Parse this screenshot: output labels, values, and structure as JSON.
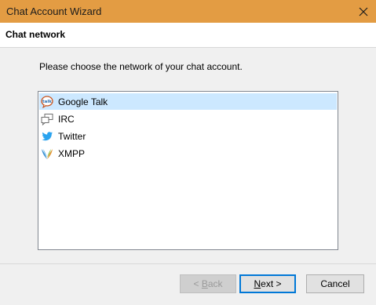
{
  "window": {
    "title": "Chat Account Wizard",
    "close_icon": "close-icon"
  },
  "header": {
    "title": "Chat network"
  },
  "prompt": "Please choose the network of your chat account.",
  "networks": [
    {
      "label": "Google Talk",
      "icon": "google-talk-icon",
      "selected": true
    },
    {
      "label": "IRC",
      "icon": "irc-icon",
      "selected": false
    },
    {
      "label": "Twitter",
      "icon": "twitter-icon",
      "selected": false
    },
    {
      "label": "XMPP",
      "icon": "xmpp-icon",
      "selected": false
    }
  ],
  "buttons": {
    "back": {
      "prefix": "< ",
      "accel": "B",
      "rest": "ack",
      "enabled": false
    },
    "next": {
      "accel": "N",
      "rest": "ext >",
      "enabled": true
    },
    "cancel": {
      "label": "Cancel",
      "enabled": true
    }
  },
  "colors": {
    "titlebar": "#e39c43",
    "selection": "#cce8ff",
    "default_button_border": "#0078d7"
  }
}
